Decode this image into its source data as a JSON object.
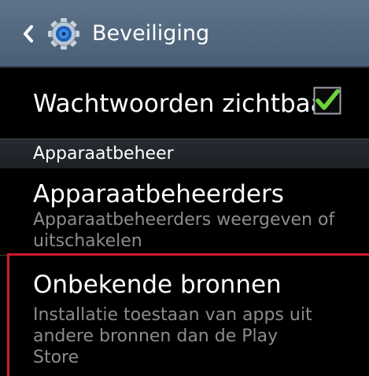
{
  "header": {
    "title": "Beveiliging",
    "back_icon": "back-chevron-icon",
    "settings_icon": "gear-icon"
  },
  "passwords_visible": {
    "label": "Wachtwoorden zichtbaar",
    "checked": true
  },
  "section": {
    "label": "Apparaatbeheer"
  },
  "device_admins": {
    "title": "Apparaatbeheerders",
    "subtitle": "Apparaatbeheerders weergeven of uitschakelen"
  },
  "unknown_sources": {
    "title": "Onbekende bronnen",
    "subtitle": "Installatie toestaan van apps uit andere bronnen dan de Play Store"
  },
  "colors": {
    "header_bg": "#55697f",
    "checkmark": "#6cd33a",
    "highlight": "#d11a2a",
    "subtitle_text": "#8c8c8c"
  }
}
